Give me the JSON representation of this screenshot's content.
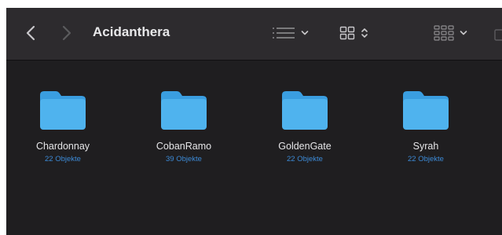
{
  "window": {
    "title": "Acidanthera"
  },
  "toolbar": {
    "back_icon": "chevron-left-icon",
    "forward_icon": "chevron-right-icon",
    "view_list_icon": "list-view-icon",
    "group_icon": "grid-view-icon",
    "arrange_icon": "group-by-icon"
  },
  "colors": {
    "toolbar_bg": "#2d2b2e",
    "content_bg": "#1f1e20",
    "folder_blue": "#4fb3ee",
    "accent_text": "#3c8ad6"
  },
  "items": [
    {
      "name": "Chardonnay",
      "count": "22 Objekte",
      "icon": "folder-icon"
    },
    {
      "name": "CobanRamo",
      "count": "39 Objekte",
      "icon": "folder-icon"
    },
    {
      "name": "GoldenGate",
      "count": "22 Objekte",
      "icon": "folder-icon"
    },
    {
      "name": "Syrah",
      "count": "22 Objekte",
      "icon": "folder-icon"
    }
  ]
}
